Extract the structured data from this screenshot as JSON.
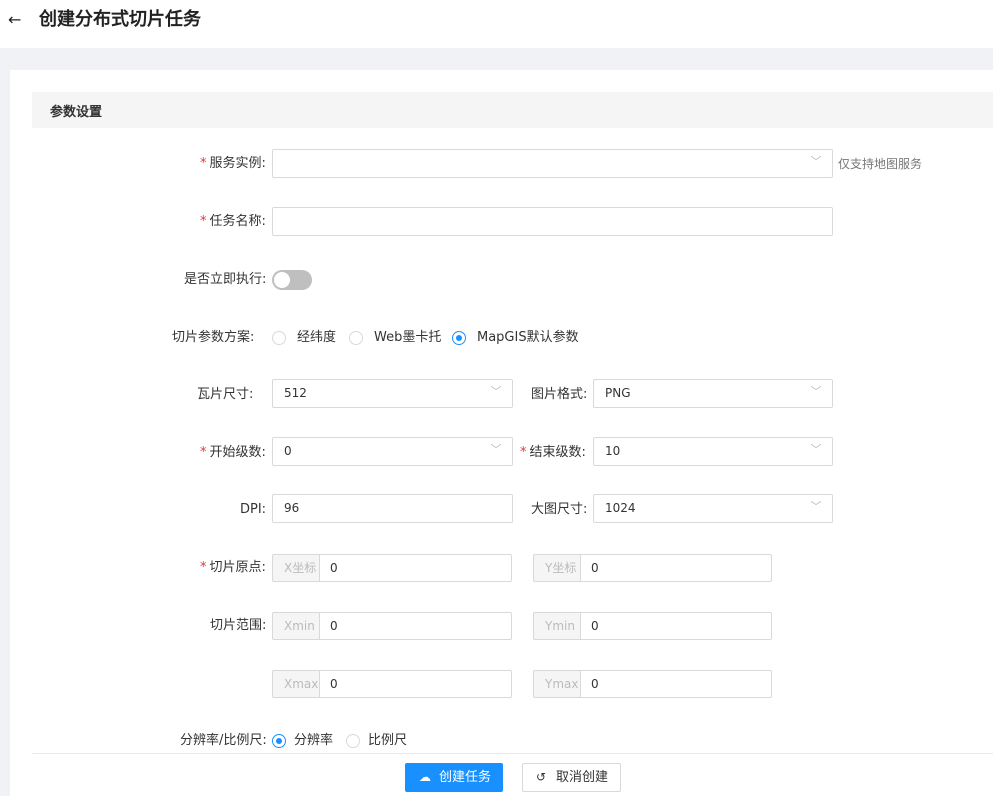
{
  "header": {
    "back_icon": "arrow-left-icon",
    "title": "创建分布式切片任务"
  },
  "section": {
    "title": "参数设置"
  },
  "form": {
    "service_instance": {
      "label": "服务实例:",
      "value": "",
      "hint": "仅支持地图服务"
    },
    "task_name": {
      "label": "任务名称:",
      "value": ""
    },
    "run_now": {
      "label": "是否立即执行:",
      "on": false
    },
    "scheme": {
      "label": "切片参数方案:",
      "options": [
        "经纬度",
        "Web墨卡托",
        "MapGIS默认参数"
      ],
      "selected": "MapGIS默认参数"
    },
    "tile_size": {
      "label": "瓦片尺寸:",
      "value": "512"
    },
    "image_format": {
      "label": "图片格式:",
      "value": "PNG"
    },
    "start_level": {
      "label": "开始级数:",
      "value": "0"
    },
    "end_level": {
      "label": "结束级数:",
      "value": "10"
    },
    "dpi": {
      "label": "DPI:",
      "value": "96"
    },
    "big_image_size": {
      "label": "大图尺寸:",
      "value": "1024"
    },
    "origin": {
      "label": "切片原点:",
      "x_addon": "X坐标",
      "x_value": "0",
      "y_addon": "Y坐标",
      "y_value": "0"
    },
    "range": {
      "label": "切片范围:",
      "xmin_addon": "Xmin",
      "xmin": "0",
      "ymin_addon": "Ymin",
      "ymin": "0",
      "xmax_addon": "Xmax",
      "xmax": "0",
      "ymax_addon": "Ymax",
      "ymax": "0"
    },
    "resolution_scale": {
      "label": "分辨率/比例尺:",
      "options": [
        "分辨率",
        "比例尺"
      ],
      "selected": "分辨率"
    }
  },
  "buttons": {
    "create": "创建任务",
    "cancel": "取消创建"
  },
  "colors": {
    "primary": "#1890ff",
    "required": "#e6333a"
  }
}
